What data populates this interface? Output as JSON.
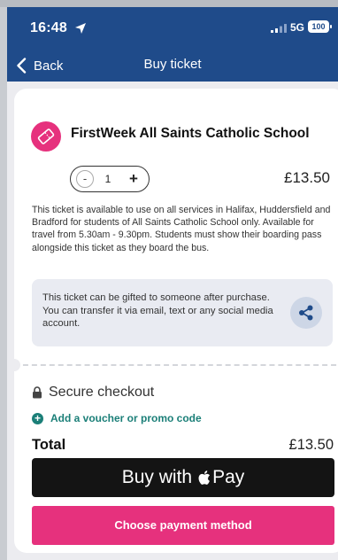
{
  "status_bar": {
    "time": "16:48",
    "network": "5G",
    "battery": "100"
  },
  "nav": {
    "back_label": "Back",
    "title": "Buy ticket"
  },
  "ticket": {
    "title": "FirstWeek All Saints Catholic School",
    "quantity": "1",
    "minus_label": "-",
    "plus_label": "+",
    "price": "£13.50",
    "description": "This ticket is available to use on all services in Halifax, Huddersfield and Bradford for students of All Saints Catholic School only. Available for travel from 5.30am - 9.30pm. Students must show their boarding pass alongside this ticket as they board the bus."
  },
  "gift": {
    "text": "This ticket can be gifted to someone after purchase. You can transfer it via email, text or any social media account."
  },
  "checkout": {
    "secure_label": "Secure checkout",
    "voucher_label": "Add a voucher or promo code",
    "total_label": "Total",
    "total_value": "£13.50",
    "apple_pay_prefix": "Buy with",
    "apple_pay_suffix": "Pay",
    "payment_method_label": "Choose payment method"
  },
  "colors": {
    "header": "#1f4b8a",
    "accent_pink": "#e6317d",
    "voucher_teal": "#1b7f78",
    "apple_pay_black": "#141414"
  },
  "icons": [
    "location-arrow-icon",
    "signal-icon",
    "battery-icon",
    "back-chevron-icon",
    "ticket-icon",
    "share-icon",
    "lock-icon",
    "plus-circle-icon",
    "apple-logo-icon"
  ]
}
